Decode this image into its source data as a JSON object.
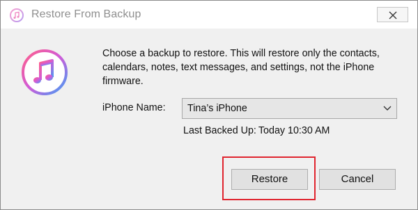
{
  "window": {
    "title": "Restore From Backup",
    "close_icon": "close-icon",
    "app_icon": "itunes-music-note-icon"
  },
  "message": "Choose a backup to restore. This will restore only the contacts, calendars, notes, text messages, and settings, not the iPhone firmware.",
  "device": {
    "label": "iPhone Name:",
    "selected": "Tina’s iPhone"
  },
  "last_backup": {
    "label": "Last Backed Up:",
    "value": "Today 10:30 AM"
  },
  "buttons": {
    "restore": "Restore",
    "cancel": "Cancel"
  },
  "colors": {
    "highlight": "#e0242e",
    "dialog_bg": "#f0f0f0"
  }
}
